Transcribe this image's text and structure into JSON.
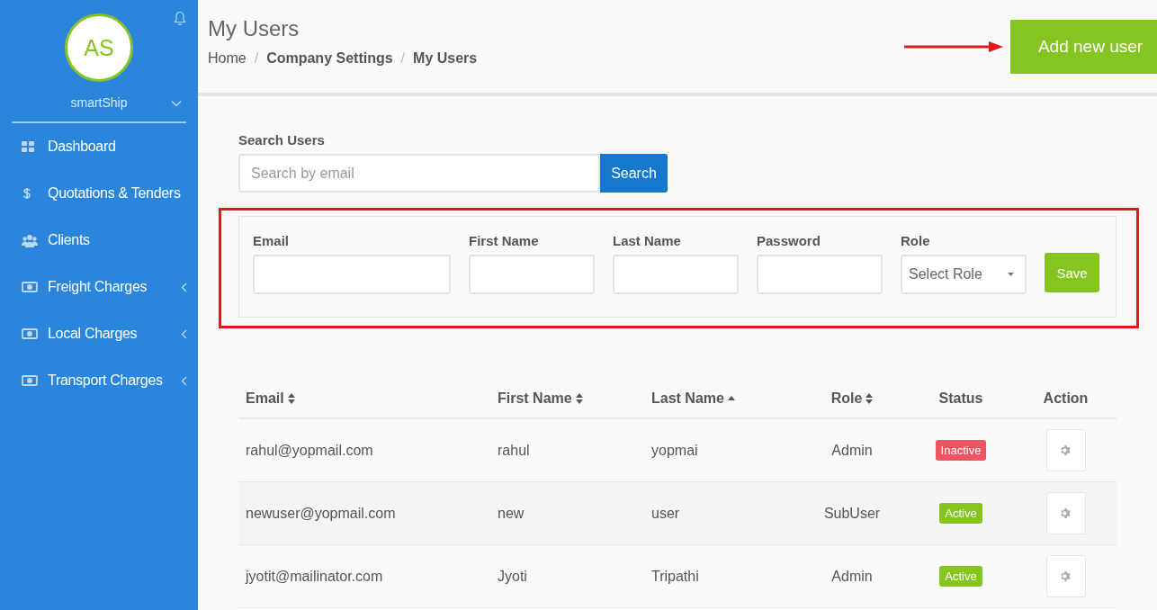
{
  "sidebar": {
    "avatar_initials": "AS",
    "account": "smartShip",
    "items": [
      {
        "label": "Dashboard",
        "expandable": false
      },
      {
        "label": "Quotations & Tenders",
        "expandable": false
      },
      {
        "label": "Clients",
        "expandable": false
      },
      {
        "label": "Freight Charges",
        "expandable": true
      },
      {
        "label": "Local Charges",
        "expandable": true
      },
      {
        "label": "Transport Charges",
        "expandable": true
      }
    ]
  },
  "header": {
    "title": "My Users",
    "breadcrumb_separator": "/",
    "breadcrumb": [
      {
        "label": "Home",
        "current": false
      },
      {
        "label": "Company Settings",
        "current": true
      },
      {
        "label": "My Users",
        "current": true
      }
    ],
    "add_button": "Add new user"
  },
  "search": {
    "label": "Search Users",
    "placeholder": "Search by email",
    "button": "Search"
  },
  "form": {
    "fields": [
      {
        "label": "Email",
        "kind": "text"
      },
      {
        "label": "First Name",
        "kind": "text"
      },
      {
        "label": "Last Name",
        "kind": "text"
      },
      {
        "label": "Password",
        "kind": "password"
      },
      {
        "label": "Role",
        "kind": "select",
        "value": "Select Role"
      }
    ],
    "button": "Save"
  },
  "table": {
    "columns": [
      {
        "label": "Email",
        "kind": "sortable"
      },
      {
        "label": "First Name",
        "kind": "sortable"
      },
      {
        "label": "Last Name",
        "kind": "sorted"
      },
      {
        "label": "Role",
        "kind": "sortable"
      },
      {
        "label": "Status",
        "kind": "plain"
      },
      {
        "label": "Action",
        "kind": "plain"
      }
    ],
    "rows": [
      {
        "email": "rahul@yopmail.com",
        "first_name": "rahul",
        "last_name": "yopmai",
        "role": "Admin",
        "status": "Inactive",
        "active": false
      },
      {
        "email": "newuser@yopmail.com",
        "first_name": "new",
        "last_name": "user",
        "role": "SubUser",
        "status": "Active",
        "active": true
      },
      {
        "email": "jyotit@mailinator.com",
        "first_name": "Jyoti",
        "last_name": "Tripathi",
        "role": "Admin",
        "status": "Active",
        "active": true
      }
    ]
  }
}
